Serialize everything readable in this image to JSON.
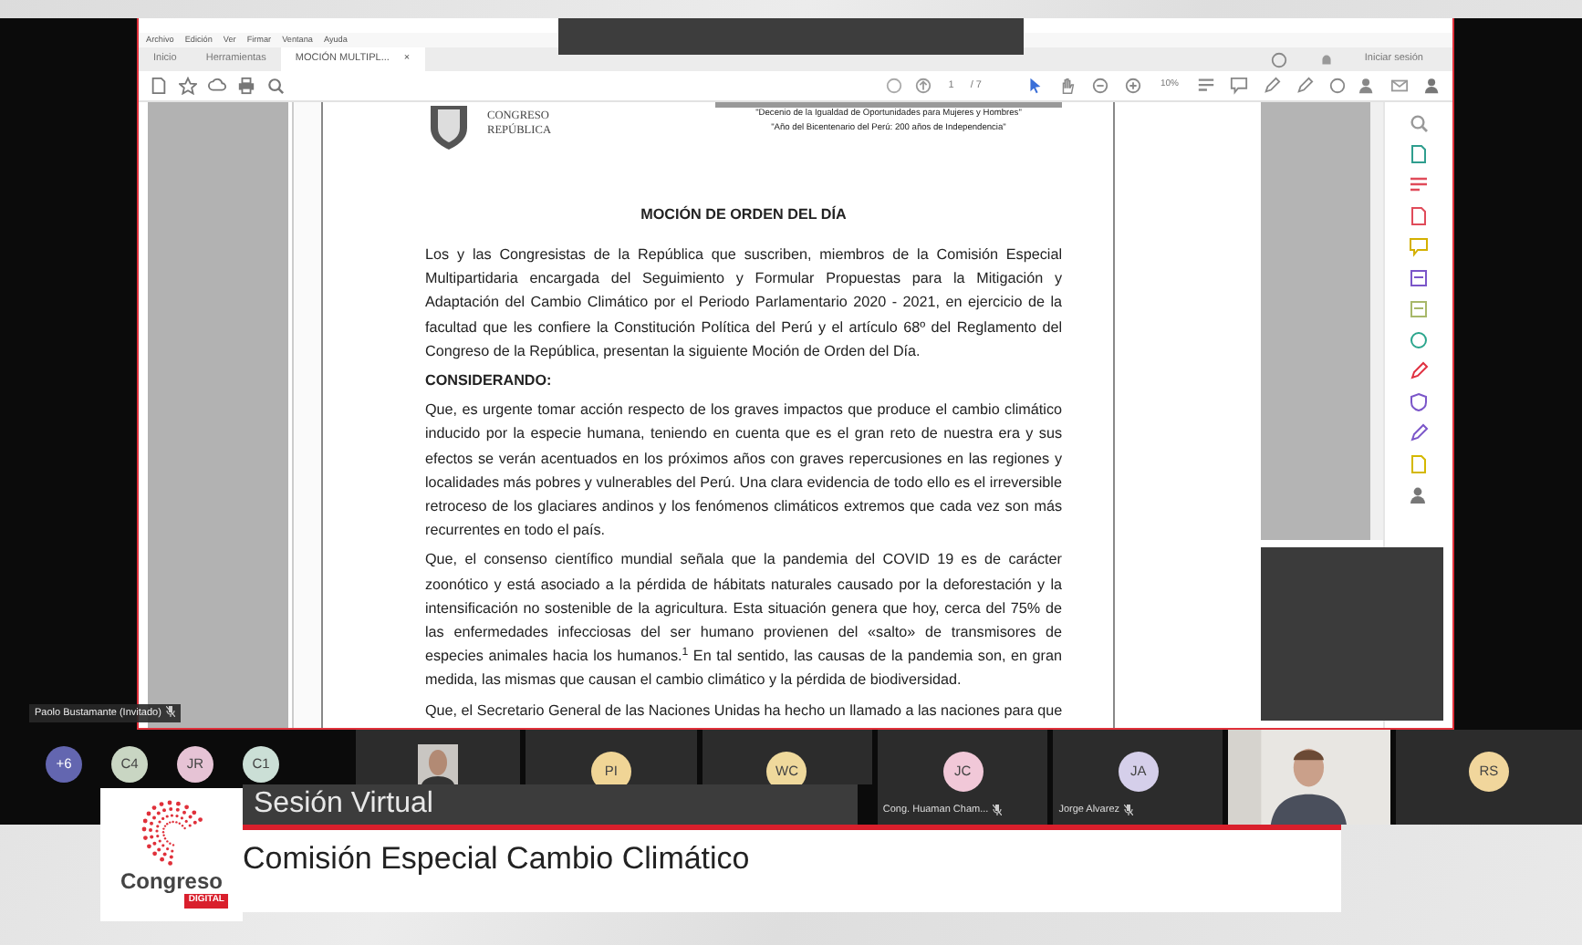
{
  "share": {
    "menu": [
      "Archivo",
      "Edición",
      "Ver",
      "Firmar",
      "Ventana",
      "Ayuda"
    ],
    "tabs": [
      {
        "label": "Inicio",
        "selected": false
      },
      {
        "label": "Herramientas",
        "selected": false
      },
      {
        "label": "MOCIÓN MULTIPL...",
        "selected": true,
        "close": "×"
      }
    ],
    "account": "Iniciar sesión",
    "page_field": "1",
    "page_total": "/ 7",
    "zoom": "10%",
    "document": {
      "org_lines": [
        "CONGRESO",
        "REPÚBLICA"
      ],
      "mottos": [
        "\"Decenio de la Igualdad de Oportunidades para Mujeres y Hombres\"",
        "\"Año del Bicentenario del Perú: 200 años de Independencia\""
      ],
      "title": "MOCIÓN DE ORDEN DEL DÍA",
      "blocks": [
        {
          "kind": "text",
          "text": "Los y las Congresistas de la República que suscriben, miembros de la Comisión Especial Multipartidaria encargada del Seguimiento y Formular Propuestas para la Mitigación y Adaptación del Cambio Climático por el Periodo Parlamentario 2020 - 2021, en ejercicio de la facultad que les confiere la Constitución Política del Perú y el artículo 68º del Reglamento del Congreso de la República, presentan la siguiente Moción de Orden del Día."
        },
        {
          "kind": "heading",
          "text": "CONSIDERANDO:"
        },
        {
          "kind": "text",
          "text": "Que, es urgente tomar acción respecto de los graves impactos que produce el cambio climático inducido por la especie humana, teniendo en cuenta que es el gran reto de nuestra era y sus efectos se verán acentuados en los próximos años con graves repercusiones en las regiones y localidades más pobres y vulnerables del Perú. Una clara evidencia de todo ello es el irreversible retroceso de los glaciares andinos y los fenómenos climáticos extremos que cada vez son más recurrentes en todo el país."
        },
        {
          "kind": "text",
          "text": "Que, el consenso científico mundial señala que la pandemia del COVID 19 es de carácter zoonótico y está asociado a la pérdida de hábitats naturales causado por la deforestación y la intensificación no sostenible de la agricultura.  Esta situación genera que hoy, cerca del 75% de las enfermedades infecciosas del ser humano provienen del «salto» de transmisores de especies animales hacia los humanos.$^{1}$ En tal sentido, las causas de la pandemia son, en gran medida, las mismas que causan el cambio climático y la pérdida de biodiversidad."
        },
        {
          "kind": "cut",
          "text": "Que, el Secretario General de las Naciones Unidas ha hecho un llamado a las naciones para que"
        }
      ]
    }
  },
  "presenter_label": "Paolo Bustamante (Invitado)",
  "participants": [
    {
      "kind": "circle",
      "initials": "+6",
      "color": "#6366b0"
    },
    {
      "kind": "circle",
      "initials": "C4",
      "color": "#c9d6c3"
    },
    {
      "kind": "circle",
      "initials": "JR",
      "color": "#e6c3d5"
    },
    {
      "kind": "circle",
      "initials": "C1",
      "color": "#cbdfd6"
    },
    {
      "kind": "thumb"
    },
    {
      "kind": "tile",
      "initials": "PI",
      "color": "#f0d596"
    },
    {
      "kind": "tile",
      "initials": "WC",
      "color": "#efd99c"
    },
    {
      "kind": "tile",
      "initials": "JC",
      "color": "#f1c8d8",
      "name": "Cong. Huaman Cham..."
    },
    {
      "kind": "tile",
      "initials": "JA",
      "color": "#d5cfea",
      "name": "Jorge Alvarez"
    },
    {
      "kind": "video"
    },
    {
      "kind": "tile",
      "initials": "RS",
      "color": "#f1d69c"
    }
  ],
  "lower_third": {
    "title": "Sesión Virtual",
    "subtitle": "Comisión Especial Cambio Climático",
    "logo_text": "Congreso",
    "logo_tag": "DIGITAL"
  }
}
